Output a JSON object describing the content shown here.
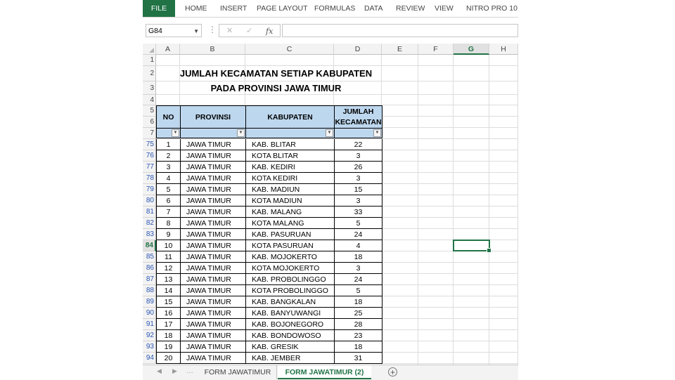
{
  "ribbon": {
    "tabs": [
      "FILE",
      "HOME",
      "INSERT",
      "PAGE LAYOUT",
      "FORMULAS",
      "DATA",
      "REVIEW",
      "VIEW",
      "NITRO PRO 10"
    ]
  },
  "formula_bar": {
    "name_box": "G84",
    "cancel_icon": "✕",
    "enter_icon": "✓",
    "fx_label": "fx",
    "formula_value": ""
  },
  "columns": [
    "A",
    "B",
    "C",
    "D",
    "E",
    "F",
    "G",
    "H"
  ],
  "selected_column": "G",
  "selected_cell": "G84",
  "row_headers_top": [
    "1",
    "2",
    "3",
    "4",
    "5",
    "6",
    "7"
  ],
  "titles": {
    "line1": "JUMLAH KECAMATAN SETIAP KABUPATEN",
    "line2": "PADA PROVINSI JAWA TIMUR"
  },
  "table": {
    "headers": [
      "NO",
      "PROVINSI",
      "KABUPATEN",
      "JUMLAH KECAMATAN"
    ],
    "filter_icons": [
      "filter-dropdown",
      "filter-active",
      "filter-dropdown",
      "filter-dropdown"
    ],
    "rows": [
      {
        "row": "75",
        "no": "1",
        "provinsi": "JAWA TIMUR",
        "kabupaten": "KAB. BLITAR",
        "jumlah": "22"
      },
      {
        "row": "76",
        "no": "2",
        "provinsi": "JAWA TIMUR",
        "kabupaten": "KOTA BLITAR",
        "jumlah": "3"
      },
      {
        "row": "77",
        "no": "3",
        "provinsi": "JAWA TIMUR",
        "kabupaten": "KAB. KEDIRI",
        "jumlah": "26"
      },
      {
        "row": "78",
        "no": "4",
        "provinsi": "JAWA TIMUR",
        "kabupaten": "KOTA KEDIRI",
        "jumlah": "3"
      },
      {
        "row": "79",
        "no": "5",
        "provinsi": "JAWA TIMUR",
        "kabupaten": "KAB. MADIUN",
        "jumlah": "15"
      },
      {
        "row": "80",
        "no": "6",
        "provinsi": "JAWA TIMUR",
        "kabupaten": "KOTA MADIUN",
        "jumlah": "3"
      },
      {
        "row": "81",
        "no": "7",
        "provinsi": "JAWA TIMUR",
        "kabupaten": "KAB. MALANG",
        "jumlah": "33"
      },
      {
        "row": "82",
        "no": "8",
        "provinsi": "JAWA TIMUR",
        "kabupaten": "KOTA MALANG",
        "jumlah": "5"
      },
      {
        "row": "83",
        "no": "9",
        "provinsi": "JAWA TIMUR",
        "kabupaten": "KAB. PASURUAN",
        "jumlah": "24"
      },
      {
        "row": "84",
        "no": "10",
        "provinsi": "JAWA TIMUR",
        "kabupaten": "KOTA PASURUAN",
        "jumlah": "4"
      },
      {
        "row": "85",
        "no": "11",
        "provinsi": "JAWA TIMUR",
        "kabupaten": "KAB. MOJOKERTO",
        "jumlah": "18"
      },
      {
        "row": "86",
        "no": "12",
        "provinsi": "JAWA TIMUR",
        "kabupaten": "KOTA MOJOKERTO",
        "jumlah": "3"
      },
      {
        "row": "87",
        "no": "13",
        "provinsi": "JAWA TIMUR",
        "kabupaten": "KAB. PROBOLINGGO",
        "jumlah": "24"
      },
      {
        "row": "88",
        "no": "14",
        "provinsi": "JAWA TIMUR",
        "kabupaten": "KOTA PROBOLINGGO",
        "jumlah": "5"
      },
      {
        "row": "89",
        "no": "15",
        "provinsi": "JAWA TIMUR",
        "kabupaten": "KAB. BANGKALAN",
        "jumlah": "18"
      },
      {
        "row": "90",
        "no": "16",
        "provinsi": "JAWA TIMUR",
        "kabupaten": "KAB. BANYUWANGI",
        "jumlah": "25"
      },
      {
        "row": "91",
        "no": "17",
        "provinsi": "JAWA TIMUR",
        "kabupaten": "KAB. BOJONEGORO",
        "jumlah": "28"
      },
      {
        "row": "92",
        "no": "18",
        "provinsi": "JAWA TIMUR",
        "kabupaten": "KAB. BONDOWOSO",
        "jumlah": "23"
      },
      {
        "row": "93",
        "no": "19",
        "provinsi": "JAWA TIMUR",
        "kabupaten": "KAB. GRESIK",
        "jumlah": "18"
      },
      {
        "row": "94",
        "no": "20",
        "provinsi": "JAWA TIMUR",
        "kabupaten": "KAB. JEMBER",
        "jumlah": "31"
      }
    ]
  },
  "sheet_tabs": {
    "tabs": [
      "FORM JAWATIMUR",
      "FORM JAWATIMUR (2)"
    ],
    "active": "FORM JAWATIMUR (2)",
    "add_icon": "+"
  },
  "colors": {
    "excel_green": "#217346",
    "header_fill": "#bdd7ee",
    "filtered_row_number": "#2a56b5"
  }
}
